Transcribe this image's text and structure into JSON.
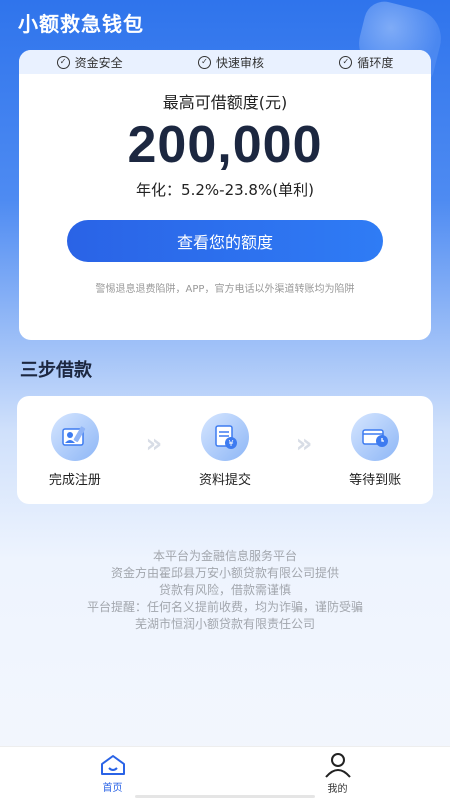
{
  "app": {
    "title": "小额救急钱包"
  },
  "features": [
    "资金安全",
    "快速审核",
    "循环度"
  ],
  "card": {
    "limit_label": "最高可借额度(元)",
    "limit_amount": "200,000",
    "rate": "年化：5.2%-23.8%(单利)",
    "cta": "查看您的额度",
    "warning": "警惕退息退费陷阱，APP，官方电话以外渠道转账均为陷阱"
  },
  "steps": {
    "title": "三步借款",
    "items": [
      {
        "label": "完成注册",
        "icon": "register-icon"
      },
      {
        "label": "资料提交",
        "icon": "document-icon"
      },
      {
        "label": "等待到账",
        "icon": "wallet-clock-icon"
      }
    ]
  },
  "disclaimer": [
    "本平台为金融信息服务平台",
    "资金方由霍邱县万安小额贷款有限公司提供",
    "贷款有风险，借款需谨慎",
    "平台提醒：任何名义提前收费，均为诈骗，谨防受骗",
    "芜湖市恒润小额贷款有限责任公司"
  ],
  "tabs": [
    {
      "label": "首页",
      "icon": "home-icon",
      "active": true
    },
    {
      "label": "我的",
      "icon": "user-icon",
      "active": false
    }
  ],
  "colors": {
    "primary": "#2a63e6",
    "amount": "#1c2740"
  }
}
